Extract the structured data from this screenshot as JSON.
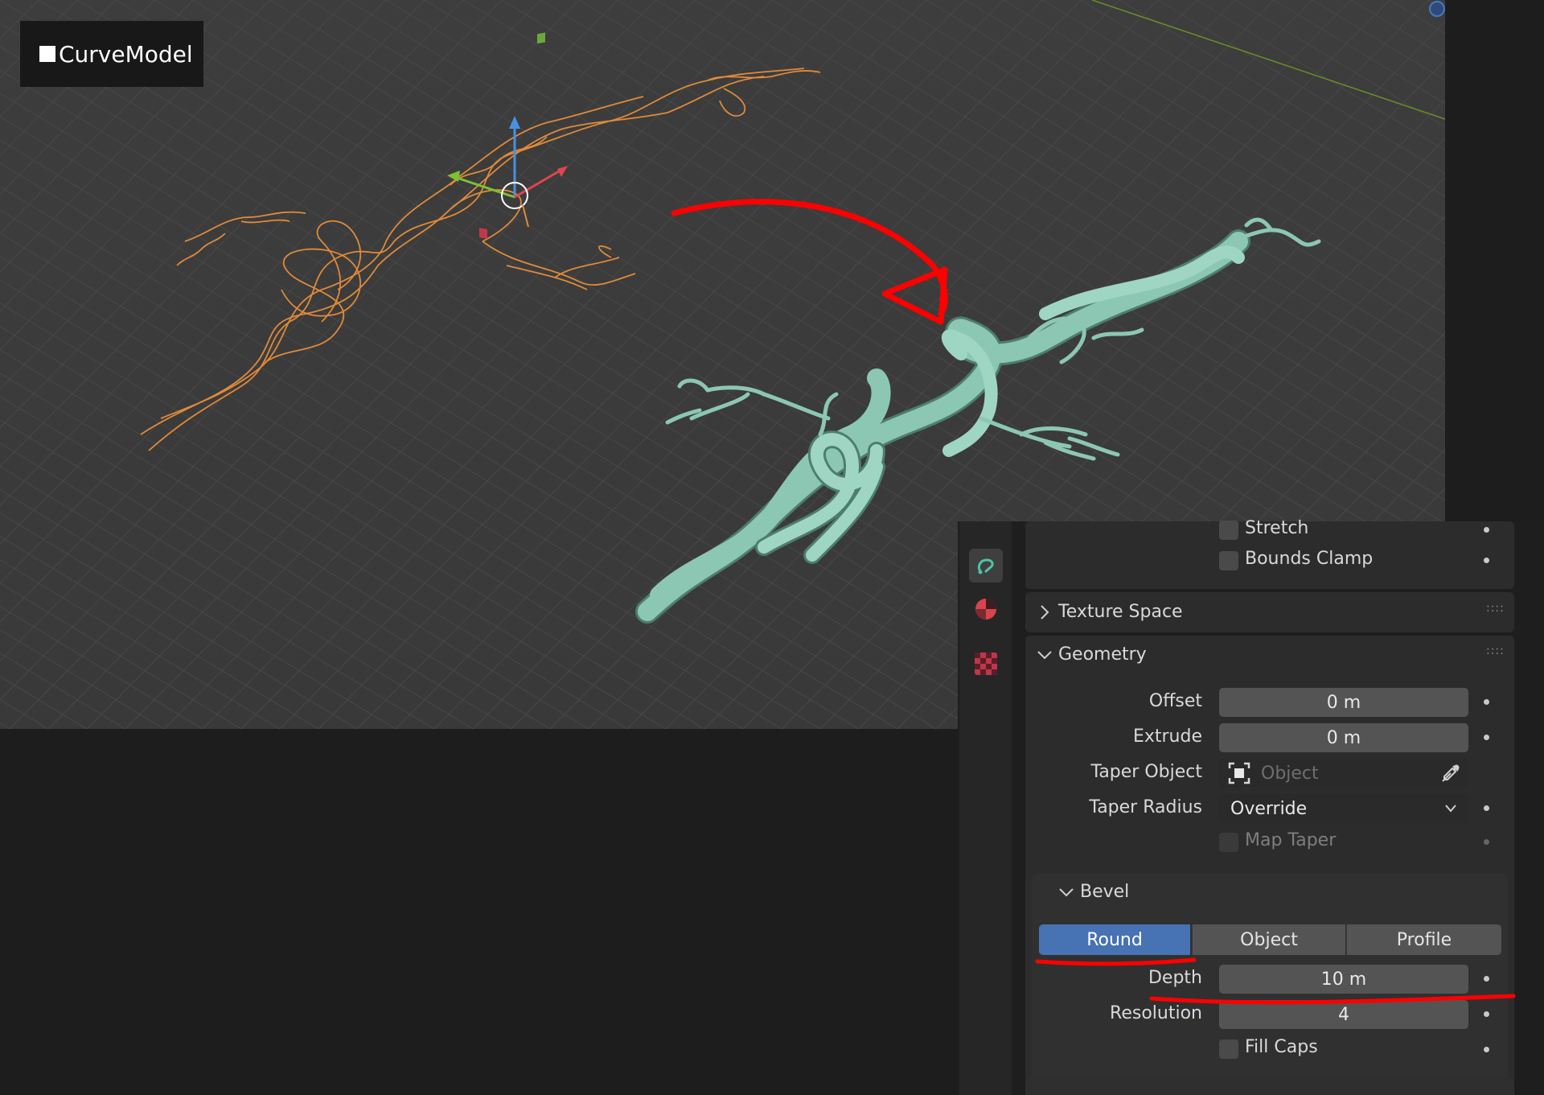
{
  "viewport": {
    "object_name": "CurveModel",
    "colors": {
      "background": "#3d3d3d",
      "grid": "#484848",
      "curve_wire": "#e08a3a",
      "mesh": "#8cc7b4",
      "annotation": "#ff0000"
    }
  },
  "properties": {
    "tabs": [
      {
        "name": "curve-data-tab",
        "icon": "curve-icon",
        "active": true
      },
      {
        "name": "material-tab",
        "icon": "material-sphere-icon",
        "active": false
      },
      {
        "name": "texture-tab",
        "icon": "checker-texture-icon",
        "active": false
      }
    ],
    "stretch_label": "Stretch",
    "bounds_clamp_label": "Bounds Clamp",
    "texture_space_label": "Texture Space",
    "geometry_label": "Geometry",
    "offset": {
      "label": "Offset",
      "value": "0 m"
    },
    "extrude": {
      "label": "Extrude",
      "value": "0 m"
    },
    "taper_object": {
      "label": "Taper Object",
      "placeholder": "Object"
    },
    "taper_radius": {
      "label": "Taper Radius",
      "value": "Override"
    },
    "map_taper_label": "Map Taper",
    "bevel": {
      "label": "Bevel",
      "modes": [
        "Round",
        "Object",
        "Profile"
      ],
      "selected": "Round",
      "depth": {
        "label": "Depth",
        "value": "10 m"
      },
      "resolution": {
        "label": "Resolution",
        "value": "4"
      },
      "fill_caps_label": "Fill Caps"
    }
  }
}
